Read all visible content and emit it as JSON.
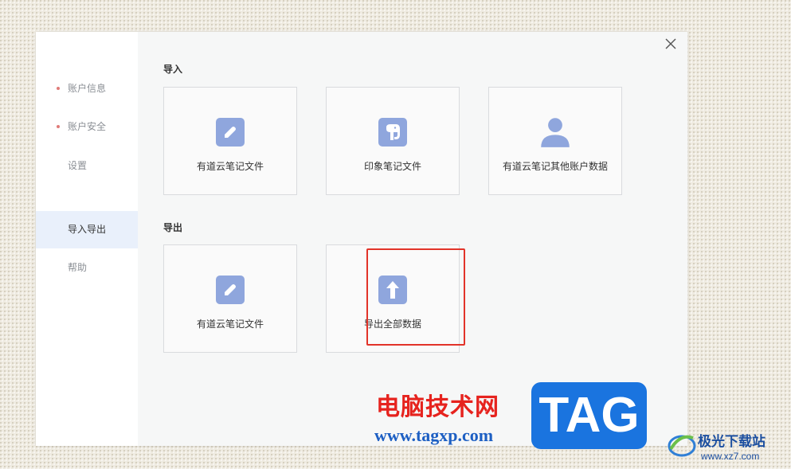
{
  "sidebar": {
    "items": [
      {
        "label": "账户信息"
      },
      {
        "label": "账户安全"
      },
      {
        "label": "设置"
      },
      {
        "label": "导入导出"
      },
      {
        "label": "帮助"
      }
    ]
  },
  "import": {
    "title": "导入",
    "cards": [
      {
        "label": "有道云笔记文件",
        "icon": "edit-icon"
      },
      {
        "label": "印象笔记文件",
        "icon": "elephant-icon"
      },
      {
        "label": "有道云笔记其他账户数据",
        "icon": "user-icon"
      }
    ]
  },
  "export": {
    "title": "导出",
    "cards": [
      {
        "label": "有道云笔记文件",
        "icon": "edit-icon"
      },
      {
        "label": "导出全部数据",
        "icon": "upload-arrow-icon"
      }
    ]
  },
  "colors": {
    "icon_bg": "#8fa6dd",
    "highlight": "#e23329",
    "active_bg": "#e9f0fb"
  },
  "watermark": {
    "site_cn": "电脑技术网",
    "site_url": "www.tagxp.com",
    "tag": "TAG",
    "brand2": "极光下载站",
    "brand2_url": "www.xz7.com"
  }
}
